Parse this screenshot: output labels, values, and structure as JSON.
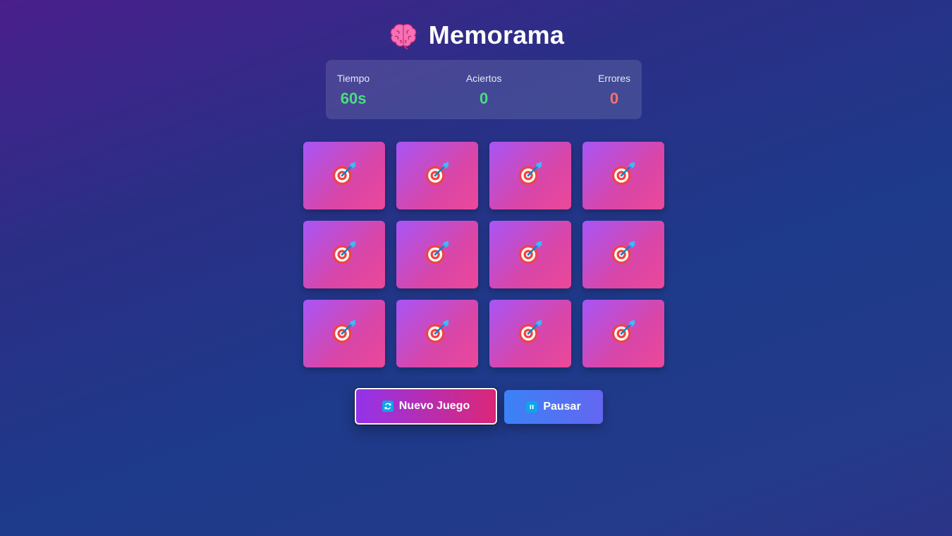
{
  "header": {
    "title": "Memorama",
    "icon": "brain-icon"
  },
  "stats": [
    {
      "label": "Tiempo",
      "value": "60s",
      "color": "#4ade80"
    },
    {
      "label": "Aciertos",
      "value": "0",
      "color": "#4ade80"
    },
    {
      "label": "Errores",
      "value": "0",
      "color": "#f87171"
    }
  ],
  "board": {
    "rows": 3,
    "columns": 4,
    "card_back_icon": "target-dart-icon",
    "card_count": 12
  },
  "buttons": {
    "new_game": {
      "label": "Nuevo Juego",
      "icon": "refresh-icon"
    },
    "pause": {
      "label": "Pausar",
      "icon": "pause-icon"
    }
  },
  "colors": {
    "card_gradient_start": "#a855f7",
    "card_gradient_end": "#ec4899",
    "new_button_start": "#9333ea",
    "new_button_end": "#db2777",
    "pause_button_start": "#3b82f6",
    "pause_button_end": "#6366f1"
  }
}
